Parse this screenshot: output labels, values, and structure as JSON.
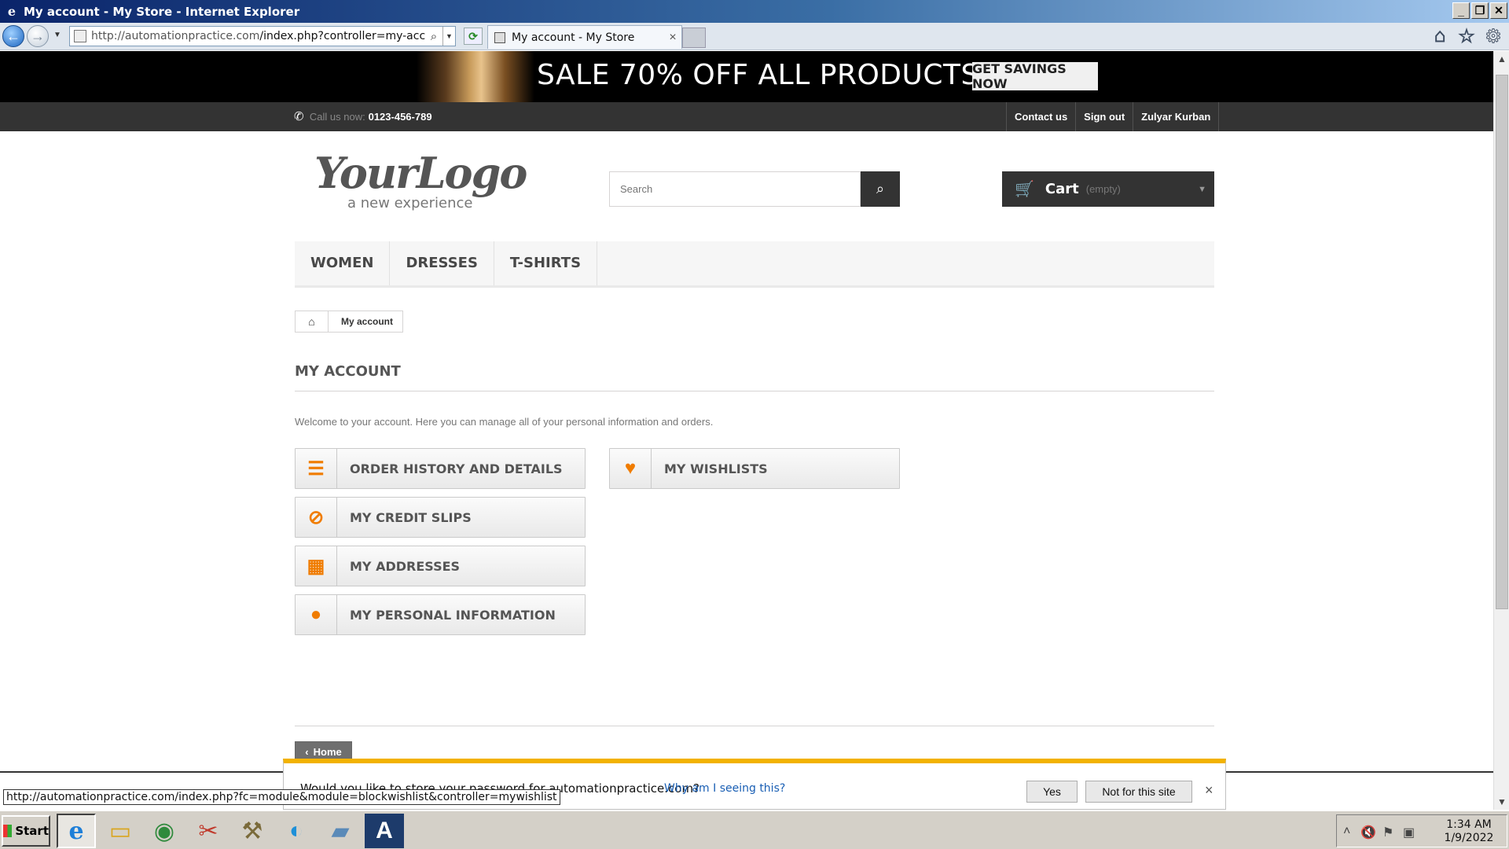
{
  "window": {
    "title": "My account - My Store - Internet Explorer",
    "url_host": "http://automationpractice.com",
    "url_path": "/index.php?controller=my-account",
    "tab_title": "My account - My Store"
  },
  "banner": {
    "headline": "SALE 70% OFF ALL PRODUCTS",
    "cta": "GET SAVINGS NOW"
  },
  "topnav": {
    "call_label": "Call us now:",
    "phone": "0123-456-789",
    "links": [
      "Contact us",
      "Sign out",
      "Zulyar Kurban"
    ]
  },
  "logo": {
    "text": "YourLogo",
    "tagline": "a new experience"
  },
  "search": {
    "placeholder": "Search"
  },
  "cart": {
    "label": "Cart",
    "status": "(empty)"
  },
  "menu": [
    "WOMEN",
    "DRESSES",
    "T-SHIRTS"
  ],
  "breadcrumb": {
    "current": "My account"
  },
  "account": {
    "heading": "MY ACCOUNT",
    "info": "Welcome to your account. Here you can manage all of your personal information and orders.",
    "buttons": [
      {
        "label": "ORDER HISTORY AND DETAILS",
        "icon": "list-ol-icon"
      },
      {
        "label": "MY CREDIT SLIPS",
        "icon": "ban-icon"
      },
      {
        "label": "MY ADDRESSES",
        "icon": "building-icon"
      },
      {
        "label": "MY PERSONAL INFORMATION",
        "icon": "user-icon"
      },
      {
        "label": "MY WISHLISTS",
        "icon": "heart-icon"
      }
    ],
    "home_button": "Home"
  },
  "password_bar": {
    "question": "Would you like to store your password for automationpractice.com?",
    "why_link": "Why am I seeing this?",
    "yes": "Yes",
    "not_for_site": "Not for this site"
  },
  "status_url": "http://automationpractice.com/index.php?fc=module&module=blockwishlist&controller=mywishlist",
  "taskbar": {
    "start": "Start",
    "time": "1:34 AM",
    "date": "1/9/2022"
  },
  "colors": {
    "accent_orange": "#f07c00",
    "dark_bar": "#333333",
    "password_bar_top": "#f2b200"
  }
}
